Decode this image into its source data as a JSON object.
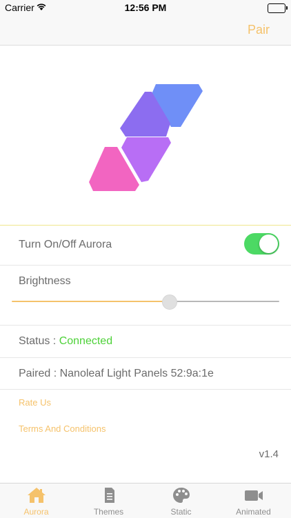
{
  "status_bar": {
    "carrier": "Carrier",
    "time": "12:56 PM",
    "battery_level": 1.0
  },
  "nav": {
    "pair_label": "Pair"
  },
  "panels": {
    "colors": [
      "#6f8ff7",
      "#8c6df0",
      "#b86ef5",
      "#f265c1"
    ]
  },
  "controls": {
    "power_label": "Turn On/Off Aurora",
    "power_on": true,
    "brightness_label": "Brightness",
    "brightness_value": 0.59
  },
  "info": {
    "status_label": "Status : ",
    "status_value": "Connected",
    "paired_text": "Paired : Nanoleaf Light Panels 52:9a:1e"
  },
  "links": {
    "rate": "Rate Us",
    "terms": "Terms And Conditions"
  },
  "version": "v1.4",
  "tabs": [
    {
      "label": "Aurora",
      "icon": "home-icon",
      "active": true
    },
    {
      "label": "Themes",
      "icon": "document-icon",
      "active": false
    },
    {
      "label": "Static",
      "icon": "palette-icon",
      "active": false
    },
    {
      "label": "Animated",
      "icon": "video-camera-icon",
      "active": false
    }
  ],
  "colors": {
    "accent": "#f5c26b",
    "toggle_on": "#4cd964",
    "connected": "#4cd137"
  }
}
